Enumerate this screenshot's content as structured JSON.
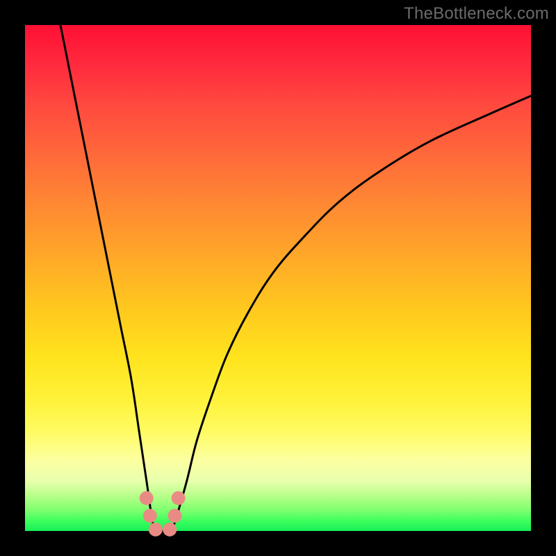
{
  "watermark": "TheBottleneck.com",
  "chart_data": {
    "type": "line",
    "title": "",
    "xlabel": "",
    "ylabel": "",
    "xlim": [
      0,
      100
    ],
    "ylim": [
      0,
      100
    ],
    "grid": false,
    "legend": false,
    "series": [
      {
        "name": "left-branch",
        "x": [
          7,
          9,
          11,
          13,
          15,
          17,
          19,
          21,
          22.5,
          24,
          25,
          25.6
        ],
        "values": [
          100,
          90,
          80,
          70,
          60,
          50,
          40,
          30,
          20,
          10,
          3,
          0
        ]
      },
      {
        "name": "flat-bottom",
        "x": [
          25.6,
          29
        ],
        "values": [
          0,
          0
        ]
      },
      {
        "name": "right-branch",
        "x": [
          29,
          30,
          32,
          34,
          37,
          40,
          44,
          49,
          55,
          62,
          70,
          80,
          92,
          100
        ],
        "values": [
          0,
          3,
          10,
          18,
          27,
          35,
          43,
          51,
          58,
          65,
          71,
          77,
          82.5,
          86
        ]
      }
    ],
    "markers": [
      {
        "name": "m1",
        "x": 24.0,
        "y": 6.5
      },
      {
        "name": "m2",
        "x": 24.7,
        "y": 3.0
      },
      {
        "name": "m3",
        "x": 25.8,
        "y": 0.3
      },
      {
        "name": "m4",
        "x": 28.6,
        "y": 0.3
      },
      {
        "name": "m5",
        "x": 29.6,
        "y": 3.0
      },
      {
        "name": "m6",
        "x": 30.3,
        "y": 6.5
      }
    ],
    "marker_color": "#e98b84",
    "curve_color": "#000000"
  }
}
